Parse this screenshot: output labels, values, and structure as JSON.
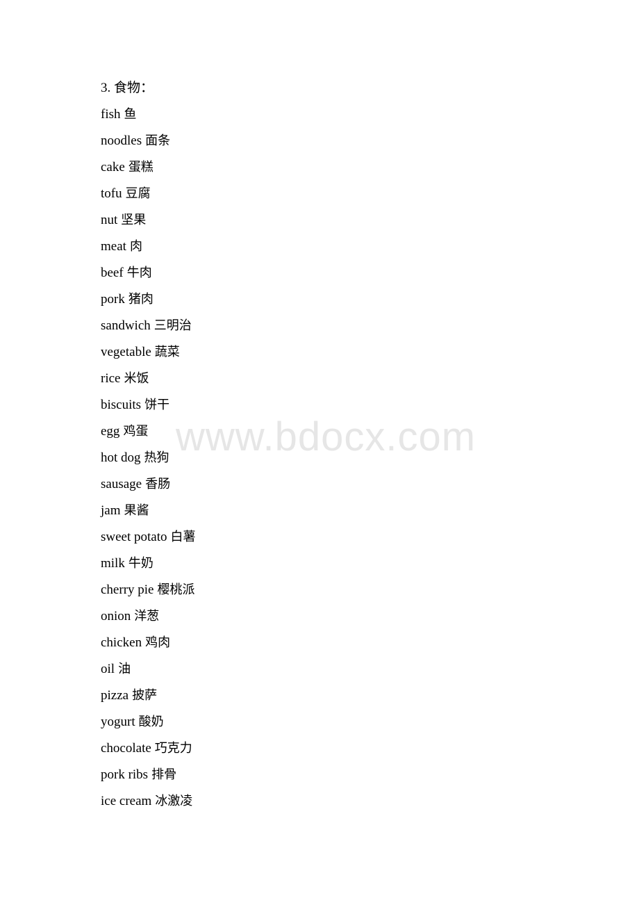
{
  "document": {
    "section_heading": "3. 食物：",
    "watermark": "www.bdocx.com",
    "watermark_color": "#e6e6e6",
    "text_color": "#000000",
    "background_color": "#ffffff"
  },
  "vocabulary": [
    {
      "term": "fish",
      "gloss": "鱼"
    },
    {
      "term": "noodles",
      "gloss": "面条"
    },
    {
      "term": "cake",
      "gloss": "蛋糕"
    },
    {
      "term": "tofu",
      "gloss": "豆腐"
    },
    {
      "term": "nut",
      "gloss": "坚果"
    },
    {
      "term": "meat",
      "gloss": "肉"
    },
    {
      "term": "beef",
      "gloss": "牛肉"
    },
    {
      "term": "pork",
      "gloss": "猪肉"
    },
    {
      "term": "sandwich",
      "gloss": "三明治"
    },
    {
      "term": "vegetable",
      "gloss": "蔬菜"
    },
    {
      "term": "rice",
      "gloss": "米饭"
    },
    {
      "term": "biscuits",
      "gloss": "饼干"
    },
    {
      "term": "egg",
      "gloss": "鸡蛋"
    },
    {
      "term": "hot dog",
      "gloss": "热狗"
    },
    {
      "term": "sausage",
      "gloss": "香肠"
    },
    {
      "term": "jam",
      "gloss": "果酱"
    },
    {
      "term": "sweet potato",
      "gloss": "白薯"
    },
    {
      "term": "milk",
      "gloss": "牛奶"
    },
    {
      "term": "cherry pie",
      "gloss": "樱桃派"
    },
    {
      "term": "onion",
      "gloss": "洋葱"
    },
    {
      "term": "chicken",
      "gloss": "鸡肉"
    },
    {
      "term": "oil",
      "gloss": "油"
    },
    {
      "term": "pizza",
      "gloss": "披萨"
    },
    {
      "term": "yogurt",
      "gloss": "酸奶"
    },
    {
      "term": "chocolate",
      "gloss": "巧克力"
    },
    {
      "term": "pork ribs",
      "gloss": "排骨"
    },
    {
      "term": "ice cream",
      "gloss": "冰激凌"
    }
  ]
}
